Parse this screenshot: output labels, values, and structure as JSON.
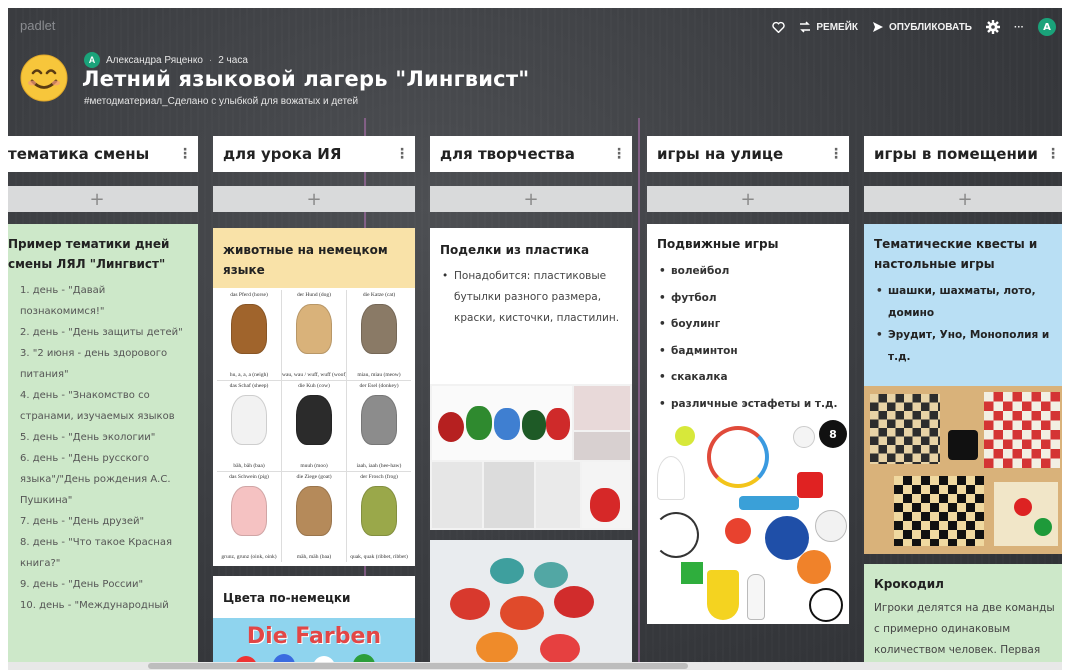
{
  "app": {
    "brand": "padlet"
  },
  "topbar": {
    "remake_label": "РЕМЕЙК",
    "publish_label": "ОПУБЛИКОВАТЬ",
    "more_label": "···",
    "avatar_letter": "A"
  },
  "header": {
    "author_letter": "A",
    "author": "Александра Ряценко",
    "separator": "·",
    "time": "2 часа",
    "title": "Летний языковой лагерь \"Лингвист\"",
    "subtitle": "#методматериал_Сделано с улыбкой для вожатых и детей"
  },
  "columns": [
    {
      "title": "тематика смены",
      "menu": "⋮",
      "add": "+"
    },
    {
      "title": "для урока ИЯ",
      "menu": "⋮",
      "add": "+"
    },
    {
      "title": "для творчества",
      "menu": "⋮",
      "add": "+"
    },
    {
      "title": "игры на улице",
      "menu": "⋮",
      "add": "+"
    },
    {
      "title": "игры в помещении",
      "menu": "⋮",
      "add": "+"
    }
  ],
  "col1": {
    "card_title": "Пример тематики дней смены ЛЯЛ \"Лингвист\"",
    "items": [
      "1. день - \"Давай познакомимся!\"",
      "2. день - \"День защиты детей\"",
      "3. \"2 июня - день здорового питания\"",
      "4. день - \"Знакомство со странами, изучаемых языков",
      "5. день - \"День экологии\"",
      "6. день - \"День русского языка\"/\"День рождения А.С. Пушкина\"",
      "7. день - \"День друзей\"",
      "8. день - \"Что такое Красная книга?\"",
      "9. день - \"День России\"",
      "10. день - \"Международный"
    ]
  },
  "col2": {
    "card1_title": "животные на немецком языке",
    "animals": [
      {
        "caption_top": "das Pferd (horse)",
        "caption_bottom": "hu, a, a, a (neigh)"
      },
      {
        "caption_top": "der Hund (dog)",
        "caption_bottom": "wau, wau / wuff, wuff (woof)"
      },
      {
        "caption_top": "die Katze (cat)",
        "caption_bottom": "miau, miau (meow)"
      },
      {
        "caption_top": "das Schaf (sheep)",
        "caption_bottom": "bäh, bäh (baa)"
      },
      {
        "caption_top": "die Kuh (cow)",
        "caption_bottom": "muuh (moo)"
      },
      {
        "caption_top": "der Esel (donkey)",
        "caption_bottom": "iaah, iaah (hee-haw)"
      },
      {
        "caption_top": "das Schwein (pig)",
        "caption_bottom": "grunz, grunz (oink, oink)"
      },
      {
        "caption_top": "die Ziege (goat)",
        "caption_bottom": "mäh, mäh (baa)"
      },
      {
        "caption_top": "der Frosch (frog)",
        "caption_bottom": "quak, quak (ribbet, ribbet)"
      }
    ],
    "card2_title": "Цвета по-немецки",
    "banner": "Die Farben"
  },
  "col3": {
    "card_title": "Поделки из пластика",
    "bullet": "Понадобится: пластиковые бутылки разного размера, краски, кисточки, пластилин."
  },
  "col4": {
    "card_title": "Подвижные игры",
    "items": [
      "волейбол",
      "футбол",
      "боулинг",
      "бадминтон",
      "скакалка",
      "различные эстафеты и т.д."
    ],
    "ball_number": "8"
  },
  "col5": {
    "card1_title": "Тематические квесты и настольные игры",
    "items": [
      "шашки, шахматы, лото, домино",
      "Эрудит, Уно, Монополия и т.д."
    ],
    "card2_title": "Крокодил",
    "card2_text": "Игроки делятся на две команды с примерно одинаковым количеством человек. Первая"
  },
  "colors": {
    "board_bg": "#3f4145",
    "col1_card": "#cde8c9",
    "col2_card_head": "#f9e2a8",
    "col4_card": "#ffffff",
    "col5_card1": "#b9dff4",
    "col5_card2": "#cde8c9",
    "accent": "#1aa37a"
  }
}
